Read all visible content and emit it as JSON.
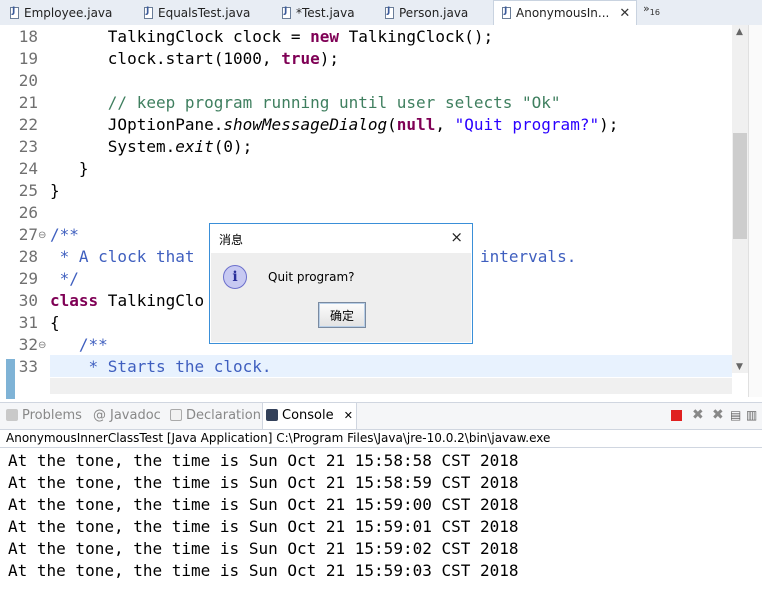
{
  "editor_tabs": [
    {
      "label": "Employee.java"
    },
    {
      "label": "EqualsTest.java"
    },
    {
      "label": "*Test.java"
    },
    {
      "label": "Person.java"
    },
    {
      "label": "AnonymousIn..."
    }
  ],
  "tab_overflow": {
    "symbol": "»",
    "count": "16"
  },
  "code_lines": {
    "n18": "18",
    "n19": "19",
    "n20": "20",
    "n21": "21",
    "n22": "22",
    "n23": "23",
    "n24": "24",
    "n25": "25",
    "n26": "26",
    "n27": "27",
    "n28": "28",
    "n29": "29",
    "n30": "30",
    "n31": "31",
    "n32": "32",
    "n33": "33"
  },
  "code": {
    "l18a": "      TalkingClock clock = ",
    "l18kw": "new",
    "l18b": " TalkingClock();",
    "l19a": "      clock.start(1000, ",
    "l19kw": "true",
    "l19b": ");",
    "l21": "      // keep program running until user selects \"Ok\"",
    "l22a": "      JOptionPane.",
    "l22it": "showMessageDialog",
    "l22b": "(",
    "l22kw": "null",
    "l22c": ", ",
    "l22st": "\"Quit program?\"",
    "l22d": ");",
    "l23a": "      System.",
    "l23it": "exit",
    "l23b": "(0);",
    "l24": "   }",
    "l25": "}",
    "l27": "/**",
    "l28a": " * A clock that ",
    "l28b": "intervals.",
    "l29": " */",
    "l30kw": "class",
    "l30b": " TalkingClo",
    "l31": "{",
    "l32": "   /**",
    "l33": "    * Starts the clock."
  },
  "dialog": {
    "title": "消息",
    "close": "×",
    "icon": "i",
    "message": "Quit program?",
    "ok_label": "确定"
  },
  "view_tabs": {
    "problems": "Problems",
    "javadoc": "Javadoc",
    "declaration": "Declaration",
    "console": "Console",
    "console_close": "✕"
  },
  "console": {
    "label": "AnonymousInnerClassTest [Java Application] C:\\Program Files\\Java\\jre-10.0.2\\bin\\javaw.exe",
    "lines": [
      "At the tone, the time is Sun Oct 21 15:58:58 CST 2018",
      "At the tone, the time is Sun Oct 21 15:58:59 CST 2018",
      "At the tone, the time is Sun Oct 21 15:59:00 CST 2018",
      "At the tone, the time is Sun Oct 21 15:59:01 CST 2018",
      "At the tone, the time is Sun Oct 21 15:59:02 CST 2018",
      "At the tone, the time is Sun Oct 21 15:59:03 CST 2018"
    ]
  },
  "colors": {
    "keyword": "#7f0055",
    "comment": "#3f7f5f",
    "javadoc": "#3f5fbf",
    "string": "#2a00ff",
    "dialog_border": "#3a8fd8",
    "terminate_red": "#e02020"
  }
}
